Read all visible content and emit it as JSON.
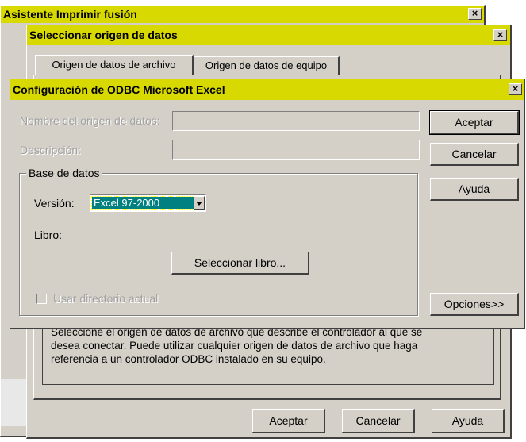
{
  "windows": {
    "wizard": {
      "title": "Asistente Imprimir fusión",
      "close_glyph": "×"
    },
    "select_source": {
      "title": "Seleccionar origen de datos",
      "close_glyph": "×",
      "tabs": [
        {
          "label": "Origen de datos de archivo",
          "active": true
        },
        {
          "label": "Origen de datos de equipo",
          "active": false
        }
      ],
      "description_lines": [
        "Seleccione el origen de datos de archivo que describe el controlador al que se",
        "desea conectar. Puede utilizar cualquier origen de datos de archivo que haga",
        "referencia a un controlador ODBC instalado en su equipo."
      ],
      "buttons": {
        "ok": "Aceptar",
        "cancel": "Cancelar",
        "help": "Ayuda"
      }
    },
    "odbc": {
      "title": "Configuración de ODBC Microsoft Excel",
      "close_glyph": "×",
      "fields": {
        "source_name_label": "Nombre del origen de datos:",
        "source_name_value": "",
        "description_label": "Descripción:",
        "description_value": ""
      },
      "database": {
        "group_label": "Base de datos",
        "version_label": "Versión:",
        "version_selected": "Excel 97-2000",
        "book_label": "Libro:",
        "select_book_button": "Seleccionar libro...",
        "use_current_dir_label": "Usar directorio actual",
        "use_current_dir_checked": false
      },
      "buttons": {
        "ok": "Aceptar",
        "cancel": "Cancelar",
        "help": "Ayuda",
        "options": "Opciones>>"
      }
    }
  },
  "colors": {
    "titlebar": "#d8d900",
    "face": "#d4d0c8",
    "select_highlight": "#008080"
  }
}
